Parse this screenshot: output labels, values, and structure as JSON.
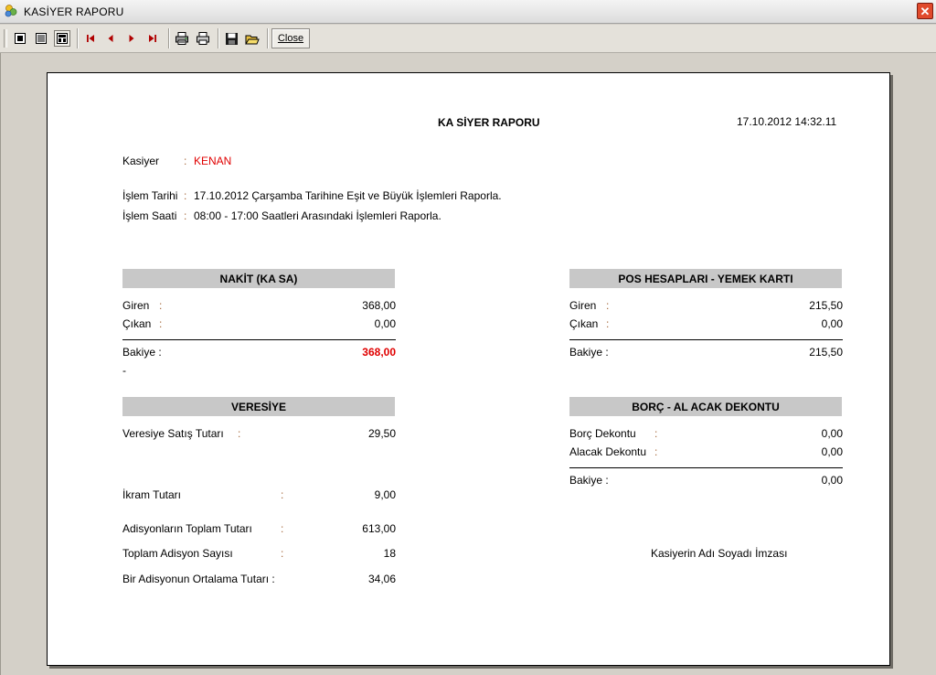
{
  "window": {
    "title": "KASİYER RAPORU",
    "close_symbol": "✕"
  },
  "toolbar": {
    "close_label": "Close"
  },
  "report": {
    "title": "KA SİYER RAPORU",
    "datetime": "17.10.2012 14:32.11",
    "cashier": {
      "label": "Kasiyer",
      "colon": ":",
      "value": "KENAN"
    },
    "date_line": {
      "label": "İşlem Tarihi",
      "colon": ":",
      "value": "17.10.2012 Çarşamba Tarihine Eşit ve Büyük İşlemleri Raporla."
    },
    "time_line": {
      "label": "İşlem Saati",
      "colon": ":",
      "value": "08:00 - 17:00 Saatleri Arasındaki İşlemleri Raporla."
    },
    "cash": {
      "header": "NAKİT (KA SA)",
      "in_label": "Giren",
      "in_colon": ":",
      "in_value": "368,00",
      "out_label": "Çıkan",
      "out_colon": ":",
      "out_value": "0,00",
      "balance_label": "Bakiye :",
      "balance_value": "368,00",
      "dash": "-"
    },
    "pos": {
      "header": "POS HESAPLARI - YEMEK KARTI",
      "in_label": "Giren",
      "in_colon": ":",
      "in_value": "215,50",
      "out_label": "Çıkan",
      "out_colon": ":",
      "out_value": "0,00",
      "balance_label": "Bakiye :",
      "balance_value": "215,50"
    },
    "credit": {
      "header": "VERESİYE",
      "sale_label": "Veresiye Satış Tutarı",
      "sale_colon": ":",
      "sale_value": "29,50"
    },
    "debt": {
      "header": "BORÇ - AL ACAK DEKONTU",
      "debt_label": "Borç Dekontu",
      "debt_colon": ":",
      "debt_value": "0,00",
      "receivable_label": "Alacak Dekontu",
      "receivable_colon": ":",
      "receivable_value": "0,00",
      "balance_label": "Bakiye :",
      "balance_value": "0,00"
    },
    "summary": {
      "treat_label": "İkram Tutarı",
      "treat_colon": ":",
      "treat_value": "9,00",
      "total_label": "Adisyonların Toplam Tutarı",
      "total_colon": ":",
      "total_value": "613,00",
      "count_label": "Toplam Adisyon Sayısı",
      "count_colon": ":",
      "count_value": "18",
      "avg_label": "Bir Adisyonun Ortalama Tutarı :",
      "avg_value": "34,06"
    },
    "signature": "Kasiyerin Adı Soyadı İmzası"
  },
  "icons": [
    "app-icon",
    "window-close-icon",
    "single-page-icon",
    "multi-page-icon",
    "page-width-icon",
    "first-page-icon",
    "prev-page-icon",
    "next-page-icon",
    "last-page-icon",
    "print-setup-icon",
    "print-icon",
    "save-icon",
    "open-icon"
  ],
  "colors": {
    "accent_red": "#e00000",
    "header_gray": "#c8c8c8",
    "colon_brown": "#a5673a"
  }
}
